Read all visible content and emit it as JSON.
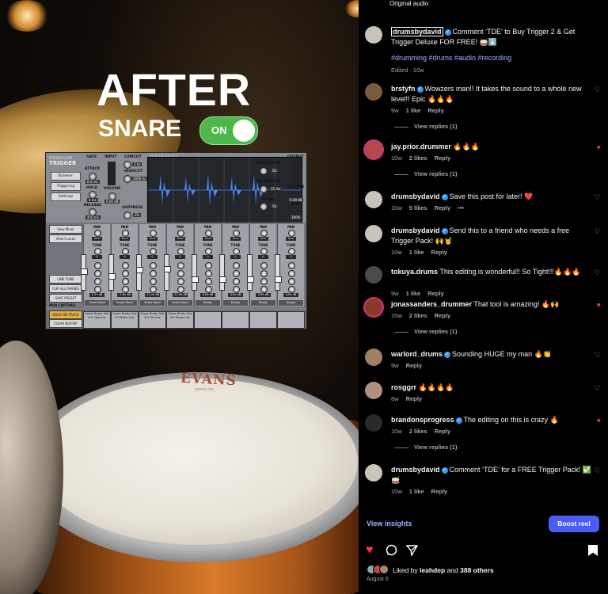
{
  "overlay": {
    "title": "AFTER",
    "subtitle": "SNARE",
    "toggle_label": "ON",
    "drum_brand": "EVANS",
    "drum_brand_sub": "genera dry"
  },
  "plugin": {
    "logo_brand": "STEVEN SLATE",
    "logo_name": "TRIGGER",
    "buttons": [
      "Browser",
      "Triggering",
      "Settings"
    ],
    "side_buttons": [
      "View Mixer",
      "View Curves"
    ],
    "side_buttons2": [
      "LINK TUNE",
      "FLIP ALL PHASES",
      "SAVE PRESET"
    ],
    "midi_label": "MIDI CAPTURE:",
    "midi_buttons": [
      "DRAG ON TRACK",
      "CLEAR BUFFER"
    ],
    "section_labels": {
      "gate": "GATE",
      "attack": "ATTACK",
      "hold": "HOLD",
      "release": "RELEASE",
      "input": "INPUT",
      "volume": "VOLUME",
      "lowcut": "LOWCUT",
      "highcut": "HIGHCUT",
      "suppress": "SUPPRESS",
      "sensitivity": "SENSITIVITY",
      "retrigger": "RETRIGGER",
      "detail": "DETAIL",
      "output": "OUTPUT",
      "mix": "MIX"
    },
    "values": {
      "attack": "0.0 ms",
      "hold": "4 ms",
      "release": "450 ms",
      "volume": "0.00 dB",
      "lowcut": "2 hz",
      "highcut": "2000 hz",
      "suppress": "0%",
      "sensitivity": "50",
      "retrigger": "15 ms",
      "detail": "50",
      "out_volume": "0.00 dB",
      "mix": "100%"
    },
    "waveform_title": "SS Brady Gak 6.5'",
    "channels": [
      {
        "name": "Snare Head",
        "db": "0.17 dB",
        "slot": "Snare Brady Gak 6.5 sTop mix",
        "fader": 0.55
      },
      {
        "name": "Snare Head",
        "db": "-1.81 dB",
        "slot": "Snare Brady Gak 6.5 BKrm mix",
        "fader": 0.4
      },
      {
        "name": "Snare Head",
        "db": "-11.22 dB",
        "slot": "Snare Brady Gak 6.5 OH mix",
        "fader": 0.6
      },
      {
        "name": "Snare Head",
        "db": "-11.83 dB",
        "slot": "Snare Brady Gak 6.5 Room mix",
        "fader": 0.62
      },
      {
        "name": "Empty",
        "db": "0.00 dB",
        "slot": "",
        "fader": 0.3
      },
      {
        "name": "Empty",
        "db": "0.00 dB",
        "slot": "",
        "fader": 0.3
      },
      {
        "name": "Empty",
        "db": "0.00 dB",
        "slot": "",
        "fader": 0.3
      },
      {
        "name": "Empty",
        "db": "0.00 dB",
        "slot": "",
        "fader": 0.3
      }
    ],
    "channel_labels": {
      "pan": "PAN",
      "pan_value": "<C>",
      "tune": "TUNE",
      "tune_value": "0"
    }
  },
  "pane": {
    "audio_label": "Original audio",
    "post": {
      "user": "drumsbydavid",
      "text": "Comment ‘TDE’ to Buy Trigger 2 & Get Trigger Deluxe FOR FREE! 🥁⬇️",
      "hashtags": "#drumming #drums #audio #recording",
      "meta": "Edited · 10w"
    },
    "comments": [
      {
        "user": "brstyfn",
        "verified": true,
        "text": "Wowzers man!! It takes the sound to a whole new level!! Epic 🔥🔥🔥",
        "time": "9w",
        "likes": "1 like",
        "reply": "Reply",
        "replies": "View replies (1)",
        "liked": false
      },
      {
        "user": "jay.prior.drummer",
        "verified": false,
        "text": "🔥🔥🔥",
        "time": "10w",
        "likes": "2 likes",
        "reply": "Reply",
        "replies": "View replies (1)",
        "liked": true
      },
      {
        "user": "drumsbydavid",
        "verified": true,
        "text": "Save this post for later! ❤️",
        "time": "10w",
        "likes": "5 likes",
        "reply": "Reply",
        "replies": "",
        "liked": false,
        "more": "•••"
      },
      {
        "user": "drumsbydavid",
        "verified": true,
        "text": "Send this to a friend who needs a free Trigger Pack! 🙌🤘",
        "time": "10w",
        "likes": "1 like",
        "reply": "Reply",
        "replies": "",
        "liked": false
      },
      {
        "user": "tokuya.drums",
        "verified": false,
        "text": "This editing is wonderful!! So Tight!!!🔥🔥🔥",
        "time": "9w",
        "likes": "1 like",
        "reply": "Reply",
        "replies": "",
        "liked": false
      },
      {
        "user": "jonassanders_drummer",
        "verified": false,
        "text": "That tool is amazing! 🔥🙌",
        "time": "10w",
        "likes": "2 likes",
        "reply": "Reply",
        "replies": "View replies (1)",
        "liked": true
      },
      {
        "user": "warlord_drums",
        "verified": true,
        "text": "Sounding HUGE my man 🔥👏",
        "time": "9w",
        "likes": "",
        "reply": "Reply",
        "replies": "",
        "liked": false
      },
      {
        "user": "rosggrr",
        "verified": false,
        "text": "🔥🔥🔥🔥",
        "time": "8w",
        "likes": "",
        "reply": "Reply",
        "replies": "",
        "liked": false
      },
      {
        "user": "brandonsprogress",
        "verified": true,
        "text": "The editing on this is crazy 🔥",
        "time": "10w",
        "likes": "2 likes",
        "reply": "Reply",
        "replies": "View replies (1)",
        "liked": true
      },
      {
        "user": "drumsbydavid",
        "verified": true,
        "text": "Comment ‘TDE’ for a FREE Trigger Pack! ✅🥁",
        "time": "10w",
        "likes": "1 like",
        "reply": "Reply",
        "replies": "",
        "liked": false
      }
    ],
    "insights_label": "View insights",
    "boost_label": "Boost reel",
    "liked_by_prefix": "Liked by",
    "liked_by_user": "leahdep",
    "liked_by_suffix": "and",
    "liked_by_count": "388 others",
    "date": "August 5",
    "colors": {
      "accent": "#4a5df9",
      "link": "#9bb4ff",
      "heart": "#ff3040",
      "toggle": "#4bb849"
    }
  }
}
